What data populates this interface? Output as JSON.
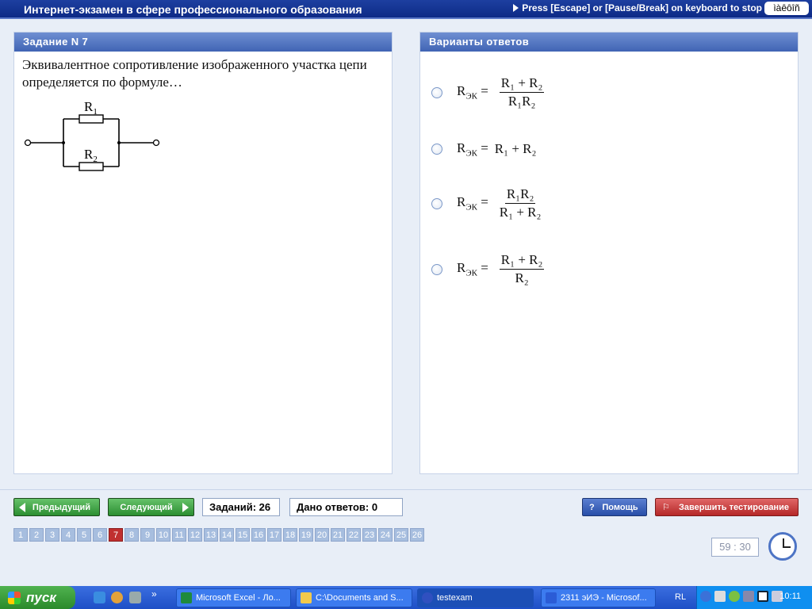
{
  "window": {
    "title": "Интернет-экзамен в сфере профессионального образования",
    "stop_hint": "Press [Escape] or [Pause/Break] on keyboard to stop",
    "lang_indicator": "ìàêôîñ"
  },
  "question": {
    "header": "Задание N 7",
    "text": "Эквивалентное сопротивление изображенного участка цепи определяется по формуле…",
    "circuit": {
      "r1_label": "R",
      "r1_sub": "1",
      "r2_label": "R",
      "r2_sub": "2"
    }
  },
  "answers": {
    "header": "Варианты ответов",
    "rek": "R",
    "rek_sub": "ЭК",
    "options": [
      {
        "num": "R₁ + R₂",
        "den": "R₁R₂"
      },
      {
        "inline": "R₁ + R₂"
      },
      {
        "num": "R₁R₂",
        "den": "R₁ + R₂"
      },
      {
        "num": "R₁ + R₂",
        "den": "R₂"
      }
    ]
  },
  "controls": {
    "prev_label": "Предыдущий",
    "next_label": "Следующий",
    "tasks_count": "Заданий: 26",
    "answered_count": "Дано ответов: 0",
    "help_label": "Помощь",
    "finish_label": "Завершить тестирование"
  },
  "navigation": {
    "numbers": [
      "1",
      "2",
      "3",
      "4",
      "5",
      "6",
      "7",
      "8",
      "9",
      "10",
      "11",
      "12",
      "13",
      "14",
      "15",
      "16",
      "17",
      "18",
      "19",
      "20",
      "21",
      "22",
      "23",
      "24",
      "25",
      "26"
    ],
    "active": "7"
  },
  "timer": {
    "value": "59 : 30"
  },
  "taskbar": {
    "start_label": "пуск",
    "tasks": [
      {
        "label": "Microsoft Excel - Ло...",
        "icon": "excel-icon"
      },
      {
        "label": "C:\\Documents and S...",
        "icon": "folder-icon"
      },
      {
        "label": "testexam",
        "icon": "app-icon"
      },
      {
        "label": "2311 эИЭ - Microsof...",
        "icon": "word-icon"
      }
    ],
    "lang": "RL",
    "clock": "10:11"
  },
  "colors": {
    "accent": "#1d3fa0",
    "active_nav": "#c02f2f",
    "green_btn": "#2b8e31",
    "red_btn": "#b52727"
  }
}
